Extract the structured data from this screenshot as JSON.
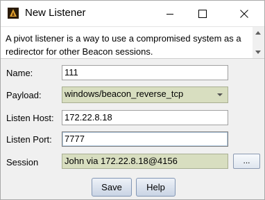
{
  "window": {
    "title": "New Listener",
    "icon": "cobalt-strike-app-icon"
  },
  "description": {
    "text": "A pivot listener is a way to use a compromised system as a redirector for other Beacon sessions."
  },
  "form": {
    "name_label": "Name:",
    "name_value": "111",
    "payload_label": "Payload:",
    "payload_value": "windows/beacon_reverse_tcp",
    "listen_host_label": "Listen Host:",
    "listen_host_value": "172.22.8.18",
    "listen_port_label": "Listen Port:",
    "listen_port_value": "7777",
    "session_label": "Session",
    "session_value": "John via  172.22.8.18@4156",
    "session_browse_label": "..."
  },
  "buttons": {
    "save_label": "Save",
    "help_label": "Help"
  },
  "colors": {
    "readonly_field_bg": "#d8dec0",
    "window_bg": "#f0f0f0",
    "button_border": "#8296b4"
  }
}
